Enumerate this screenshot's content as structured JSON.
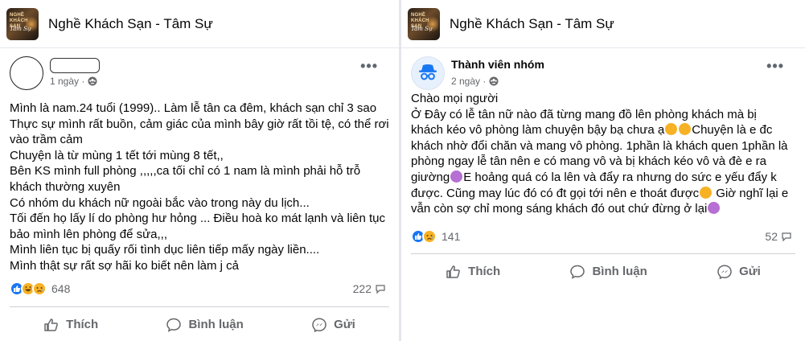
{
  "left_post": {
    "group_name": "Nghề Khách Sạn - Tâm Sự",
    "group_thumb_text_1": "NGHỀ KHÁCH SẠN",
    "group_thumb_text_2": "Tâm Sự",
    "time": "1 ngày ·",
    "body_lines": [
      "Mình là nam.24 tuổi (1999).. Làm lễ tân ca đêm, khách sạn chỉ 3 sao",
      "Thực sự mình rất buồn, cảm giác của mình bây giờ rất tồi tệ, có thể rơi",
      "vào trầm cảm",
      "Chuyện là từ mùng 1 tết tới mùng 8 tết,,",
      "Bên KS mình full phòng ,,,,,ca tối chỉ có 1 nam là mình phải hỗ trỗ",
      "khách thường xuyên",
      "Có nhóm du khách nữ ngoài bắc vào trong này du lịch...",
      "Tối đến họ lấy lí do phòng hư hỏng ... Điều hoà ko mát lạnh và liên tục",
      "bảo mình lên phòng để sửa,,,",
      "Mình liên tục bị quấy rối tình dục liên tiếp mấy ngày liền....",
      "Mình thật sự rất sợ hãi ko biết nên làm j cả"
    ],
    "reaction_count": "648",
    "comment_count": "222",
    "actions": {
      "like": "Thích",
      "comment": "Bình luận",
      "send": "Gửi"
    }
  },
  "right_post": {
    "group_name": "Nghề Khách Sạn - Tâm Sự",
    "group_thumb_text_1": "NGHỀ KHÁCH SẠN",
    "group_thumb_text_2": "Tâm Sự",
    "author": "Thành viên nhóm",
    "time": "2 ngày ·",
    "body_lines": [
      "Chào mọi người",
      "Ở Đây có lễ tân nữ nào đã từng mang đồ lên phòng khách mà bị",
      "khách kéo vô phòng làm chuyện bậy bạ chưa ạ",
      "Chuyện là e đc",
      "khách nhờ đổi chăn và mang vô phòng. 1phần là khách quen 1phần là",
      "phòng ngay lễ tân nên e có mang vô và bị khách kéo vô và đè e ra",
      "giường",
      "E hoảng quá có la lên và đẩy ra nhưng do sức e yếu đẩy k",
      "được. Cũng may lúc đó có đt gọi tới nên e thoát được",
      " Giờ nghĩ lại e",
      "vẫn còn sợ chỉ mong sáng khách đó out chứ đừng ở lại"
    ],
    "reaction_count": "141",
    "comment_count": "52",
    "actions": {
      "like": "Thích",
      "comment": "Bình luận",
      "send": "Gửi"
    }
  }
}
